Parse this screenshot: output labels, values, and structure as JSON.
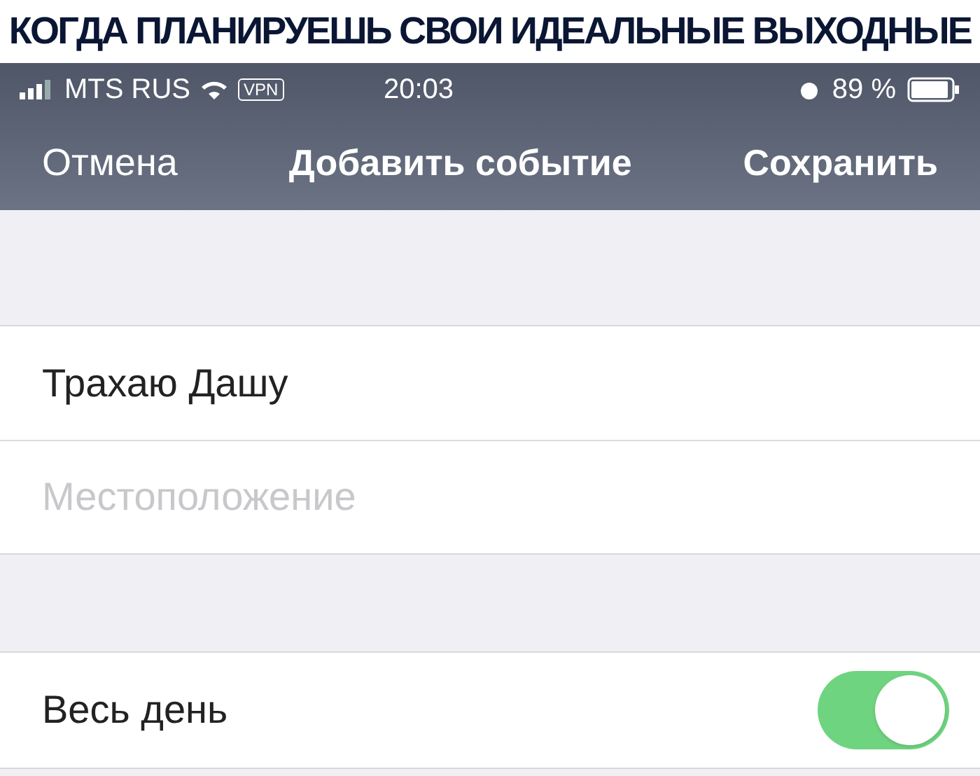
{
  "caption": "КОГДА ПЛАНИРУЕШЬ СВОИ ИДЕАЛЬНЫЕ ВЫХОДНЫЕ",
  "status_bar": {
    "carrier": "MTS RUS",
    "vpn": "VPN",
    "time": "20:03",
    "battery": "89 %"
  },
  "nav": {
    "cancel": "Отмена",
    "title": "Добавить событие",
    "save": "Сохранить"
  },
  "fields": [
    {
      "value": "Трахаю Дашу"
    },
    {
      "placeholder": "Местоположение"
    }
  ],
  "all_day": {
    "label": "Весь день",
    "on": true
  }
}
